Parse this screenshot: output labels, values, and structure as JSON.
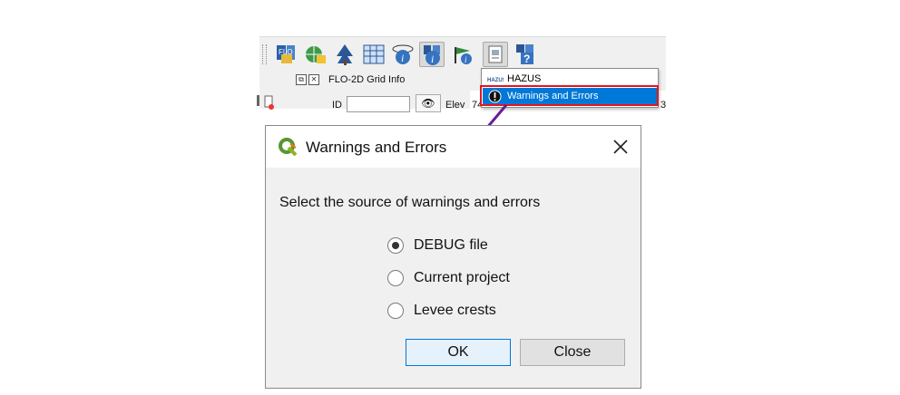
{
  "toolbar": {
    "icons": [
      "flo2d-tools-icon",
      "grid-globe-icon",
      "tree-icon",
      "table-grid-icon",
      "info-icon",
      "info-active-icon",
      "info-flag-icon",
      "debug-tool-icon",
      "help-icon"
    ]
  },
  "panel": {
    "title": "FLO-2D Grid Info",
    "id_label": "ID",
    "elev_label": "Elev",
    "elev_value_fragment": "74",
    "right_fragment": "3"
  },
  "menu": {
    "items": [
      {
        "label": "HAZUS",
        "icon": "hazus-icon"
      },
      {
        "label": "Warnings and Errors",
        "icon": "exclamation-icon",
        "selected": true
      }
    ],
    "highlight_color": "#0078d7",
    "annotation_color": "#e3161d"
  },
  "arrow_color": "#6a1b9a",
  "dialog": {
    "title": "Warnings and Errors",
    "prompt": "Select the source of warnings and errors",
    "options": [
      {
        "label": "DEBUG file",
        "checked": true
      },
      {
        "label": "Current project",
        "checked": false
      },
      {
        "label": "Levee crests",
        "checked": false
      }
    ],
    "ok_label": "OK",
    "close_label": "Close"
  }
}
